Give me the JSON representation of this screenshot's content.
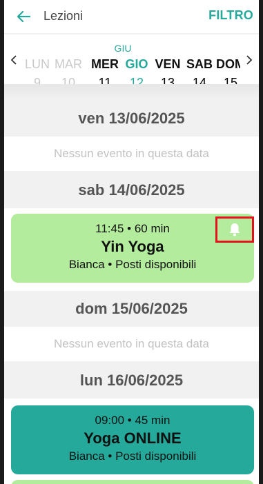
{
  "header": {
    "title": "Lezioni",
    "filter_label": "FILTRO",
    "back_icon": "arrow-left-icon"
  },
  "week": {
    "month": "GIU",
    "days": [
      {
        "name": "LUN",
        "date": "9"
      },
      {
        "name": "MAR",
        "date": "10"
      },
      {
        "name": "MER",
        "date": "11"
      },
      {
        "name": "GIO",
        "date": "12"
      },
      {
        "name": "VEN",
        "date": "13"
      },
      {
        "name": "SAB",
        "date": "14"
      },
      {
        "name": "DOM",
        "date": "15"
      }
    ],
    "prev_icon": "chevron-left-icon",
    "next_icon": "chevron-right-icon"
  },
  "schedule": {
    "fri_header": "ven 13/06/2025",
    "fri_empty": "Nessun evento in questa data",
    "sat_header": "sab 14/06/2025",
    "sat_event": {
      "time": "11:45 • 60 min",
      "name": "Yin Yoga",
      "meta": "Bianca • Posti disponibili",
      "notify_icon": "bell-icon"
    },
    "sun_header": "dom 15/06/2025",
    "sun_empty": "Nessun evento in questa data",
    "mon_header": "lun 16/06/2025",
    "mon_event": {
      "time": "09:00 • 45 min",
      "name": "Yoga ONLINE",
      "meta": "Bianca • Posti disponibili"
    }
  },
  "colors": {
    "accent": "#25a99a",
    "card_light": "#b3ec9c",
    "highlight": "#e0141c"
  }
}
